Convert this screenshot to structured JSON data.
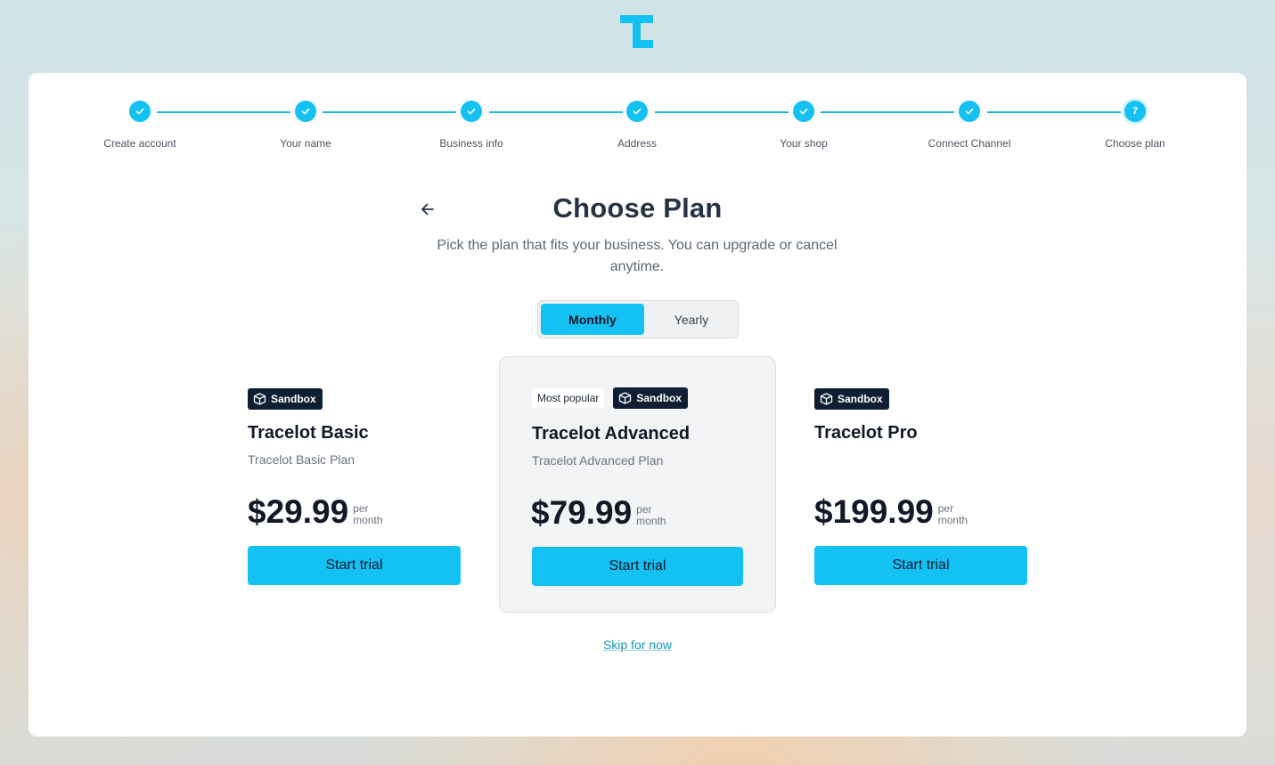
{
  "logo": {
    "icon": "tracelot-logo-icon",
    "color": "#13c2f2"
  },
  "steps": [
    {
      "label": "Create account",
      "state": "done"
    },
    {
      "label": "Your name",
      "state": "done"
    },
    {
      "label": "Business info",
      "state": "done"
    },
    {
      "label": "Address",
      "state": "done"
    },
    {
      "label": "Your shop",
      "state": "done"
    },
    {
      "label": "Connect Channel",
      "state": "done"
    },
    {
      "label": "Choose plan",
      "state": "current",
      "number": "7"
    }
  ],
  "header": {
    "back_icon": "arrow-left-icon",
    "title": "Choose Plan",
    "subtitle": "Pick the plan that fits your business. You can upgrade or cancel anytime."
  },
  "billing": {
    "options": [
      "Monthly",
      "Yearly"
    ],
    "selected": "Monthly"
  },
  "plans": [
    {
      "sandbox_label": "Sandbox",
      "name": "Tracelot Basic",
      "description": "Tracelot Basic Plan",
      "price": "$29.99",
      "period_top": "per",
      "period_bottom": "month",
      "cta": "Start trial"
    },
    {
      "popular_label": "Most popular",
      "sandbox_label": "Sandbox",
      "name": "Tracelot Advanced",
      "description": "Tracelot Advanced Plan",
      "price": "$79.99",
      "period_top": "per",
      "period_bottom": "month",
      "cta": "Start trial"
    },
    {
      "sandbox_label": "Sandbox",
      "name": "Tracelot Pro",
      "description": "",
      "price": "$199.99",
      "period_top": "per",
      "period_bottom": "month",
      "cta": "Start trial"
    }
  ],
  "skip_label": "Skip for now",
  "colors": {
    "accent": "#13c2f2",
    "sandbox_badge": "#0e1f33",
    "link": "#1597b8"
  }
}
